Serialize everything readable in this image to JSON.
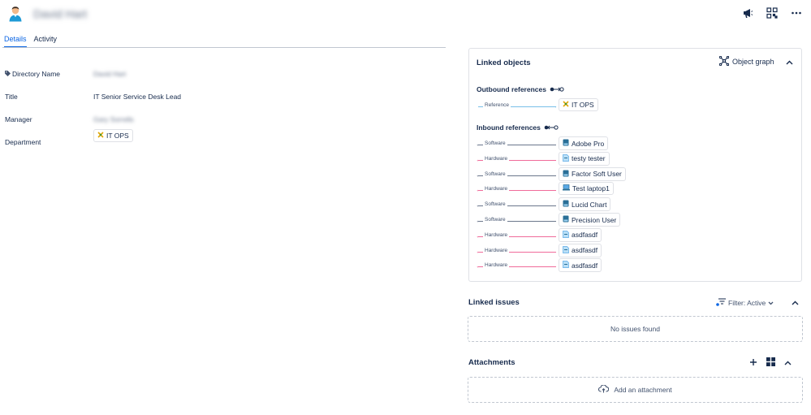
{
  "header": {
    "user_name": "David Hart",
    "actions": [
      "announce-icon",
      "qr-code-icon",
      "more-icon"
    ]
  },
  "tabs": [
    {
      "label": "Details",
      "active": true
    },
    {
      "label": "Activity",
      "active": false
    }
  ],
  "fields": [
    {
      "label": "Directory Name",
      "value": "David Hart",
      "blurred": true,
      "icon": "tag-icon"
    },
    {
      "label": "Title",
      "value": "IT Senior Service Desk Lead",
      "blurred": false
    },
    {
      "label": "Manager",
      "value": "Gary Sorrells",
      "blurred": true
    },
    {
      "label": "Department",
      "value": "IT OPS",
      "chip": true
    }
  ],
  "linked_objects": {
    "title": "Linked objects",
    "graph_label": "Object graph",
    "outbound_title": "Outbound references",
    "inbound_title": "Inbound references",
    "outbound": [
      {
        "relation": "Reference",
        "target": "IT OPS",
        "color": "#79c0e8",
        "icon": "department-icon"
      }
    ],
    "inbound": [
      {
        "relation": "Software",
        "target": "Adobe Pro",
        "color": "#6b778c",
        "icon": "software-icon"
      },
      {
        "relation": "Hardware",
        "target": "testy tester",
        "color": "#f06b9a",
        "icon": "hardware-icon"
      },
      {
        "relation": "Software",
        "target": "Factor Soft User",
        "color": "#6b778c",
        "icon": "software-icon"
      },
      {
        "relation": "Hardware",
        "target": "Test laptop1",
        "color": "#f06b9a",
        "icon": "laptop-icon"
      },
      {
        "relation": "Software",
        "target": "Lucid Chart",
        "color": "#6b778c",
        "icon": "software-icon"
      },
      {
        "relation": "Software",
        "target": "Precision User",
        "color": "#6b778c",
        "icon": "software-icon"
      },
      {
        "relation": "Hardware",
        "target": "asdfasdf",
        "color": "#f06b9a",
        "icon": "hardware-icon"
      },
      {
        "relation": "Hardware",
        "target": "asdfasdf",
        "color": "#f06b9a",
        "icon": "hardware-icon"
      },
      {
        "relation": "Hardware",
        "target": "asdfasdf",
        "color": "#f06b9a",
        "icon": "hardware-icon"
      }
    ]
  },
  "linked_issues": {
    "title": "Linked issues",
    "filter_label": "Filter: Active",
    "empty_text": "No issues found"
  },
  "attachments": {
    "title": "Attachments",
    "add_label": "Add an attachment"
  }
}
